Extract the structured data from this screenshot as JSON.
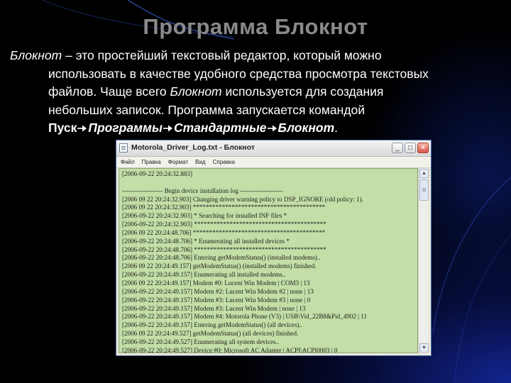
{
  "slide": {
    "title": "Программа Блокнот",
    "para": {
      "term": "Блокнот",
      "line1_rest": " – это простейший текстовый редактор, который можно",
      "line2": "использовать в качестве удобного средства просмотра текстовых",
      "line3_a": "файлов. Чаще всего ",
      "line3_b": "Блокнот",
      "line3_c": " используется для создания",
      "line4": "небольших записок. Программа запускается командой",
      "path": [
        "Пуск",
        "Программы",
        "Стандартные",
        "Блокнот"
      ],
      "end": "."
    }
  },
  "window": {
    "title": "Motorola_Driver_Log.txt - Блокнот",
    "menu": [
      "Файл",
      "Правка",
      "Формат",
      "Вид",
      "Справка"
    ],
    "lines": [
      "[2006-09-22 20:24:32.883]",
      "",
      "------------------- Begin device installation log --------------------",
      "[2006 09 22 20:24:32.903] Changing driver warning policy to DSP_IGNORE (old policy: 1).",
      "[2006 09 22 20:24:32.903] *****************************************",
      "[2006-09-22 20:24:32.903] * Searching for installed INF files *",
      "[2006-09-22 20:24:32.903] *****************************************",
      "[2006 09 22 20:24:48.706] *****************************************",
      "[2006-09-22 20:24:48.706] * Enumerating all installed devices *",
      "[2006-09-22 20:24:48.706] *****************************************",
      "[2006-09-22 20:24:48.706] Entering getModemStatus() (installed modems)..",
      "[2006 09 22 20:24:49.157] getModemStatus() (installed modems) finished.",
      "[2006-09-22 20:24:49.157] Enumerating all installed modems..",
      "[2006 09 22 20:24:49.157] Modem #0: Lucent Win Modem | COM3 | 13",
      "[2006-09-22 20:24:49.157] Modem #2: Lucent Win Modem #2 | none | 13",
      "[2006-09-22 20:24:49.157] Modem #3: Lucent Win Modem #3 | none | 0",
      "[2006-09-22 20:24:49.157] Modem #3: Lucent Win Modem | none | 13",
      "[2006-09-22 20:24:49.157] Modem #4: Motorola Phone (V3) | USB\\Vid_22B8&Pid_4902 | 11",
      "[2006-09-22 20:24:49.157] Entering getModemStatus() (all devices)..",
      "[2006 09 22 20:24:49.527] getModemStatus() (all devices) finished.",
      "[2006-09-22 20:24:49.527] Enumerating all system devices..",
      "[2006-09-22 20:24:49.527] Device #0: Microsoft AC Adapter | ACPI\\ACPI0003 | 0"
    ]
  },
  "colors": {
    "title": "#8a8a8a",
    "body_text": "#ffffff",
    "editor_bg": "#c3dea6"
  }
}
